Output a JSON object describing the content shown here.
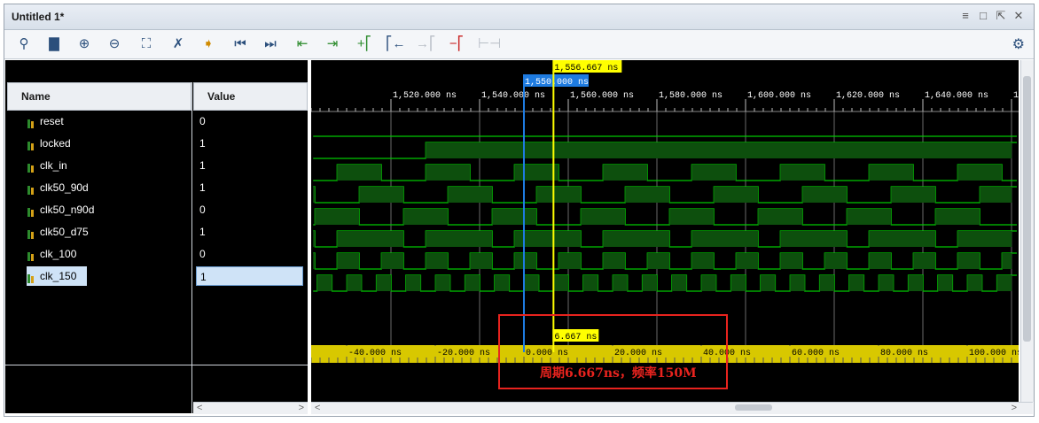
{
  "window": {
    "title": "Untitled 1*"
  },
  "window_controls": [
    "≡",
    "□",
    "⇱",
    "✕"
  ],
  "toolbar": {
    "icons": [
      "search-icon",
      "save-icon",
      "zoom-in-icon",
      "zoom-out-icon",
      "zoom-fit-icon",
      "marker-icon",
      "go-to-cursor-icon",
      "go-to-time-0-icon",
      "go-to-last-time-icon",
      "previous-transition-icon",
      "next-transition-icon",
      "add-marker-icon",
      "previous-marker-icon",
      "next-marker-icon",
      "swap-cursors-icon",
      "snap-to-transition-icon"
    ],
    "disabled": [
      false,
      false,
      false,
      false,
      false,
      false,
      false,
      false,
      false,
      false,
      false,
      false,
      false,
      true,
      false,
      true
    ]
  },
  "columns": {
    "name": "Name",
    "value": "Value"
  },
  "signals": [
    {
      "name": "reset",
      "value": "0"
    },
    {
      "name": "locked",
      "value": "1"
    },
    {
      "name": "clk_in",
      "value": "1"
    },
    {
      "name": "clk50_90d",
      "value": "1"
    },
    {
      "name": "clk50_n90d",
      "value": "0"
    },
    {
      "name": "clk50_d75",
      "value": "1"
    },
    {
      "name": "clk_100",
      "value": "0"
    },
    {
      "name": "clk_150",
      "value": "1"
    }
  ],
  "selected_signal": "clk_150",
  "time_axis": {
    "labels": [
      "1,520.000 ns",
      "1,540.000 ns",
      "1,560.000 ns",
      "1,580.000 ns",
      "1,600.000 ns",
      "1,620.000 ns",
      "1,640.000 ns",
      "1,6"
    ]
  },
  "cursors": {
    "main": "1,556.667 ns",
    "marker": "1,550.000 ns",
    "delta": "6.667 ns"
  },
  "relative_axis": {
    "labels": [
      "-40.000 ns",
      "-20.000 ns",
      "0.000 ns",
      "20.000 ns",
      "40.000 ns",
      "60.000 ns",
      "80.000 ns",
      "100.000 ns"
    ]
  },
  "annotation": "周期6.667ns，频率150M",
  "colors": {
    "wave": "#00c800",
    "marker": "#1e7be0",
    "cursor": "#ffff00",
    "annotation_box": "#e8231e",
    "ruler": "#d8c800"
  }
}
